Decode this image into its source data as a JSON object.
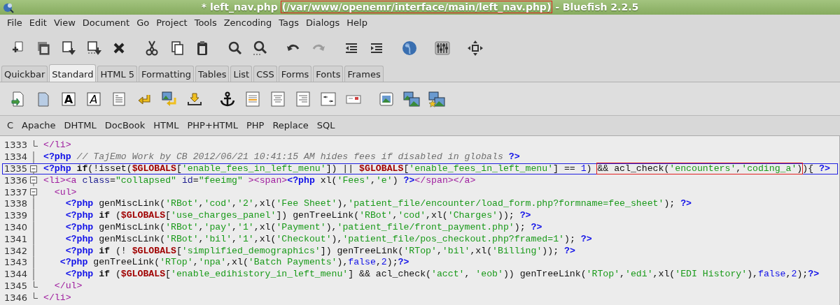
{
  "window": {
    "title_parts": [
      {
        "kind": "plain",
        "text": "* left_nav.php"
      },
      {
        "kind": "boxed",
        "text": "(/var/www/openemr/interface/main/left_nav.php)"
      },
      {
        "kind": "plain",
        "text": "- Bluefish 2.2.5"
      }
    ]
  },
  "menu": [
    "File",
    "Edit",
    "View",
    "Document",
    "Go",
    "Project",
    "Tools",
    "Zencoding",
    "Tags",
    "Dialogs",
    "Help"
  ],
  "main_toolbar": [
    {
      "disabled": false
    },
    {
      "disabled": false
    },
    {
      "disabled": false
    },
    {
      "disabled": false
    },
    {
      "disabled": false
    },
    {
      "disabled": false
    },
    {
      "disabled": false
    },
    {
      "disabled": false
    },
    {
      "disabled": false
    },
    {
      "disabled": false
    },
    {
      "disabled": false
    },
    {
      "disabled": true
    },
    {
      "disabled": false
    },
    {
      "disabled": false
    },
    {
      "disabled": false
    },
    {
      "disabled": false
    },
    {
      "disabled": false
    }
  ],
  "tabs": [
    {
      "label": "Quickbar",
      "selected": false
    },
    {
      "label": "Standard",
      "selected": true
    },
    {
      "label": "HTML 5",
      "selected": false
    },
    {
      "label": "Formatting",
      "selected": false
    },
    {
      "label": "Tables",
      "selected": false
    },
    {
      "label": "List",
      "selected": false
    },
    {
      "label": "CSS",
      "selected": false
    },
    {
      "label": "Forms",
      "selected": false
    },
    {
      "label": "Fonts",
      "selected": false
    },
    {
      "label": "Frames",
      "selected": false
    }
  ],
  "standard_toolbar": {
    "bold_glyph": "A",
    "italic_glyph": "A"
  },
  "snippets_menu": [
    "C",
    "Apache",
    "DHTML",
    "DocBook",
    "HTML",
    "PHP+HTML",
    "PHP",
    "Replace",
    "SQL"
  ],
  "editor": {
    "lines": [
      {
        "number": "1333",
        "fold_toggle": false,
        "block_end": true,
        "highlighted": false,
        "tokens": [
          {
            "kind": "tag",
            "text": "</li>"
          }
        ]
      },
      {
        "number": "1334",
        "fold_toggle": false,
        "block_end": false,
        "highlighted": false,
        "tokens": [
          {
            "kind": "php",
            "text": "<?php"
          },
          {
            "kind": "comment",
            "text": " // TajEmo Work by CB 2012/06/21 10:41:15 AM hides fees if disabled in globals "
          },
          {
            "kind": "php",
            "text": "?>"
          }
        ]
      },
      {
        "number": "1335",
        "fold_toggle": true,
        "block_end": false,
        "highlighted": true,
        "tokens": [
          {
            "kind": "php",
            "text": "<?php "
          },
          {
            "kind": "keyword",
            "text": "if"
          },
          {
            "kind": "plain",
            "text": "(!isset("
          },
          {
            "kind": "variable",
            "text": "$GLOBALS"
          },
          {
            "kind": "plain",
            "text": "["
          },
          {
            "kind": "string",
            "text": "'enable_fees_in_left_menu'"
          },
          {
            "kind": "plain",
            "text": "]) || "
          },
          {
            "kind": "variable",
            "text": "$GLOBALS"
          },
          {
            "kind": "plain",
            "text": "["
          },
          {
            "kind": "string",
            "text": "'enable_fees_in_left_menu'"
          },
          {
            "kind": "plain",
            "text": "] == "
          },
          {
            "kind": "number",
            "text": "1"
          },
          {
            "kind": "plain",
            "text": ") "
          },
          {
            "kind": "boxed",
            "tokens": [
              {
                "kind": "plain",
                "text": "&& acl_check("
              },
              {
                "kind": "string",
                "text": "'encounters'"
              },
              {
                "kind": "plain",
                "text": ","
              },
              {
                "kind": "string",
                "text": "'coding_a'"
              },
              {
                "kind": "plain",
                "text": ")"
              }
            ]
          },
          {
            "kind": "plain",
            "text": "){ "
          },
          {
            "kind": "php",
            "text": "?>"
          }
        ]
      },
      {
        "number": "1336",
        "fold_toggle": true,
        "block_end": false,
        "highlighted": false,
        "tokens": [
          {
            "kind": "tag",
            "text": "<li><a "
          },
          {
            "kind": "attribute",
            "text": "class"
          },
          {
            "kind": "plain",
            "text": "="
          },
          {
            "kind": "string",
            "text": "\"collapsed\" "
          },
          {
            "kind": "attribute",
            "text": "id"
          },
          {
            "kind": "plain",
            "text": "="
          },
          {
            "kind": "string",
            "text": "\"feeimg\" "
          },
          {
            "kind": "tag",
            "text": "><span>"
          },
          {
            "kind": "php",
            "text": "<?php"
          },
          {
            "kind": "plain",
            "text": " xl("
          },
          {
            "kind": "string",
            "text": "'Fees'"
          },
          {
            "kind": "plain",
            "text": ","
          },
          {
            "kind": "string",
            "text": "'e'"
          },
          {
            "kind": "plain",
            "text": ") "
          },
          {
            "kind": "php",
            "text": "?>"
          },
          {
            "kind": "tag",
            "text": "</span></a>"
          }
        ]
      },
      {
        "number": "1337",
        "fold_toggle": true,
        "block_end": false,
        "highlighted": false,
        "tokens": [
          {
            "kind": "tag",
            "text": "  <ul>"
          }
        ]
      },
      {
        "number": "1338",
        "fold_toggle": false,
        "block_end": false,
        "highlighted": false,
        "tokens": [
          {
            "kind": "php",
            "text": "    <?php"
          },
          {
            "kind": "plain",
            "text": " genMiscLink("
          },
          {
            "kind": "string",
            "text": "'RBot'"
          },
          {
            "kind": "plain",
            "text": ","
          },
          {
            "kind": "string",
            "text": "'cod'"
          },
          {
            "kind": "plain",
            "text": ","
          },
          {
            "kind": "string",
            "text": "'2'"
          },
          {
            "kind": "plain",
            "text": ",xl("
          },
          {
            "kind": "string",
            "text": "'Fee Sheet'"
          },
          {
            "kind": "plain",
            "text": "),"
          },
          {
            "kind": "string",
            "text": "'patient_file/encounter/load_form.php?formname=fee_sheet'"
          },
          {
            "kind": "plain",
            "text": "); "
          },
          {
            "kind": "php",
            "text": "?>"
          }
        ]
      },
      {
        "number": "1339",
        "fold_toggle": false,
        "block_end": false,
        "highlighted": false,
        "tokens": [
          {
            "kind": "php",
            "text": "    <?php "
          },
          {
            "kind": "keyword",
            "text": "if"
          },
          {
            "kind": "plain",
            "text": " ("
          },
          {
            "kind": "variable",
            "text": "$GLOBALS"
          },
          {
            "kind": "plain",
            "text": "["
          },
          {
            "kind": "string",
            "text": "'use_charges_panel'"
          },
          {
            "kind": "plain",
            "text": "]) genTreeLink("
          },
          {
            "kind": "string",
            "text": "'RBot'"
          },
          {
            "kind": "plain",
            "text": ","
          },
          {
            "kind": "string",
            "text": "'cod'"
          },
          {
            "kind": "plain",
            "text": ",xl("
          },
          {
            "kind": "string",
            "text": "'Charges'"
          },
          {
            "kind": "plain",
            "text": ")); "
          },
          {
            "kind": "php",
            "text": "?>"
          }
        ]
      },
      {
        "number": "1340",
        "fold_toggle": false,
        "block_end": false,
        "highlighted": false,
        "tokens": [
          {
            "kind": "php",
            "text": "    <?php"
          },
          {
            "kind": "plain",
            "text": " genMiscLink("
          },
          {
            "kind": "string",
            "text": "'RBot'"
          },
          {
            "kind": "plain",
            "text": ","
          },
          {
            "kind": "string",
            "text": "'pay'"
          },
          {
            "kind": "plain",
            "text": ","
          },
          {
            "kind": "string",
            "text": "'1'"
          },
          {
            "kind": "plain",
            "text": ",xl("
          },
          {
            "kind": "string",
            "text": "'Payment'"
          },
          {
            "kind": "plain",
            "text": "),"
          },
          {
            "kind": "string",
            "text": "'patient_file/front_payment.php'"
          },
          {
            "kind": "plain",
            "text": "); "
          },
          {
            "kind": "php",
            "text": "?>"
          }
        ]
      },
      {
        "number": "1341",
        "fold_toggle": false,
        "block_end": false,
        "highlighted": false,
        "tokens": [
          {
            "kind": "php",
            "text": "    <?php"
          },
          {
            "kind": "plain",
            "text": " genMiscLink("
          },
          {
            "kind": "string",
            "text": "'RBot'"
          },
          {
            "kind": "plain",
            "text": ","
          },
          {
            "kind": "string",
            "text": "'bil'"
          },
          {
            "kind": "plain",
            "text": ","
          },
          {
            "kind": "string",
            "text": "'1'"
          },
          {
            "kind": "plain",
            "text": ",xl("
          },
          {
            "kind": "string",
            "text": "'Checkout'"
          },
          {
            "kind": "plain",
            "text": "),"
          },
          {
            "kind": "string",
            "text": "'patient_file/pos_checkout.php?framed=1'"
          },
          {
            "kind": "plain",
            "text": "); "
          },
          {
            "kind": "php",
            "text": "?>"
          }
        ]
      },
      {
        "number": "1342",
        "fold_toggle": false,
        "block_end": false,
        "highlighted": false,
        "tokens": [
          {
            "kind": "php",
            "text": "    <?php "
          },
          {
            "kind": "keyword",
            "text": "if"
          },
          {
            "kind": "plain",
            "text": " (! "
          },
          {
            "kind": "variable",
            "text": "$GLOBALS"
          },
          {
            "kind": "plain",
            "text": "["
          },
          {
            "kind": "string",
            "text": "'simplified_demographics'"
          },
          {
            "kind": "plain",
            "text": "]) genTreeLink("
          },
          {
            "kind": "string",
            "text": "'RTop'"
          },
          {
            "kind": "plain",
            "text": ","
          },
          {
            "kind": "string",
            "text": "'bil'"
          },
          {
            "kind": "plain",
            "text": ",xl("
          },
          {
            "kind": "string",
            "text": "'Billing'"
          },
          {
            "kind": "plain",
            "text": ")); "
          },
          {
            "kind": "php",
            "text": "?>"
          }
        ]
      },
      {
        "number": "1343",
        "fold_toggle": false,
        "block_end": false,
        "highlighted": false,
        "tokens": [
          {
            "kind": "php",
            "text": "   <?php"
          },
          {
            "kind": "plain",
            "text": " genTreeLink("
          },
          {
            "kind": "string",
            "text": "'RTop'"
          },
          {
            "kind": "plain",
            "text": ","
          },
          {
            "kind": "string",
            "text": "'npa'"
          },
          {
            "kind": "plain",
            "text": ",xl("
          },
          {
            "kind": "string",
            "text": "'Batch Payments'"
          },
          {
            "kind": "plain",
            "text": "),"
          },
          {
            "kind": "number",
            "text": "false"
          },
          {
            "kind": "plain",
            "text": ","
          },
          {
            "kind": "number",
            "text": "2"
          },
          {
            "kind": "plain",
            "text": ");"
          },
          {
            "kind": "php",
            "text": "?>"
          }
        ]
      },
      {
        "number": "1344",
        "fold_toggle": false,
        "block_end": false,
        "highlighted": false,
        "tokens": [
          {
            "kind": "php",
            "text": "    <?php "
          },
          {
            "kind": "keyword",
            "text": "if"
          },
          {
            "kind": "plain",
            "text": " ("
          },
          {
            "kind": "variable",
            "text": "$GLOBALS"
          },
          {
            "kind": "plain",
            "text": "["
          },
          {
            "kind": "string",
            "text": "'enable_edihistory_in_left_menu'"
          },
          {
            "kind": "plain",
            "text": "] && acl_check("
          },
          {
            "kind": "string",
            "text": "'acct'"
          },
          {
            "kind": "plain",
            "text": ", "
          },
          {
            "kind": "string",
            "text": "'eob'"
          },
          {
            "kind": "plain",
            "text": ")) genTreeLink("
          },
          {
            "kind": "string",
            "text": "'RTop'"
          },
          {
            "kind": "plain",
            "text": ","
          },
          {
            "kind": "string",
            "text": "'edi'"
          },
          {
            "kind": "plain",
            "text": ",xl("
          },
          {
            "kind": "string",
            "text": "'EDI History'"
          },
          {
            "kind": "plain",
            "text": "),"
          },
          {
            "kind": "number",
            "text": "false"
          },
          {
            "kind": "plain",
            "text": ","
          },
          {
            "kind": "number",
            "text": "2"
          },
          {
            "kind": "plain",
            "text": ");"
          },
          {
            "kind": "php",
            "text": "?>"
          }
        ]
      },
      {
        "number": "1345",
        "fold_toggle": false,
        "block_end": true,
        "highlighted": false,
        "tokens": [
          {
            "kind": "tag",
            "text": "  </ul>"
          }
        ]
      },
      {
        "number": "1346",
        "fold_toggle": false,
        "block_end": true,
        "highlighted": false,
        "tokens": [
          {
            "kind": "tag",
            "text": "</li>"
          }
        ]
      }
    ]
  }
}
